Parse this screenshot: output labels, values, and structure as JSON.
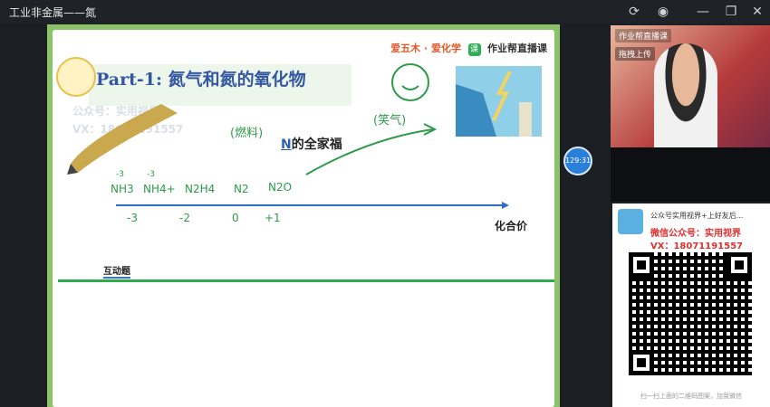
{
  "window": {
    "title": "工业非金属——氮",
    "icons": [
      "refresh-icon",
      "eye-icon",
      "minimize-icon",
      "maximize-icon",
      "close-icon"
    ]
  },
  "slide": {
    "brand_ai": "爱五木 · 爱化学",
    "brand_logo": "课",
    "brand_text": "作业帮直播课",
    "heading_en": "Part-1: ",
    "heading_cn": "氮气和氮的氧化物",
    "watermark_line1": "公众号：实用视界",
    "watermark_line2": "VX：18071191557",
    "subtitle_n": "N",
    "subtitle_rest": "的全家福",
    "interaction": "互动题",
    "axis_label": "化合价",
    "handwriting": {
      "n1": "NH3",
      "n2": "NH4+",
      "n3": "N2H4",
      "n4": "N2",
      "n5": "N2O",
      "v1": "-3",
      "v2": "-2",
      "v3": "0",
      "v4": "+1",
      "sup1": "-3",
      "sup2": "-3",
      "note1": "(燃料)",
      "note2": "(笑气)"
    }
  },
  "timer": "129:31",
  "video": {
    "label": "作业帮直播课",
    "upload": "拖拽上传"
  },
  "promo": {
    "line1": "公众号实用视界+上好友后...",
    "line2": "微信公众号：实用视界",
    "line3": "VX：18071191557",
    "foot": "扫一扫上面的二维码图案，加我微信"
  },
  "colors": {
    "frame_green": "#8cc26a",
    "heading_blue": "#3457a2",
    "ink_green": "#2e9a4a",
    "ink_blue": "#2d6ec2",
    "accent_red": "#e03030"
  }
}
